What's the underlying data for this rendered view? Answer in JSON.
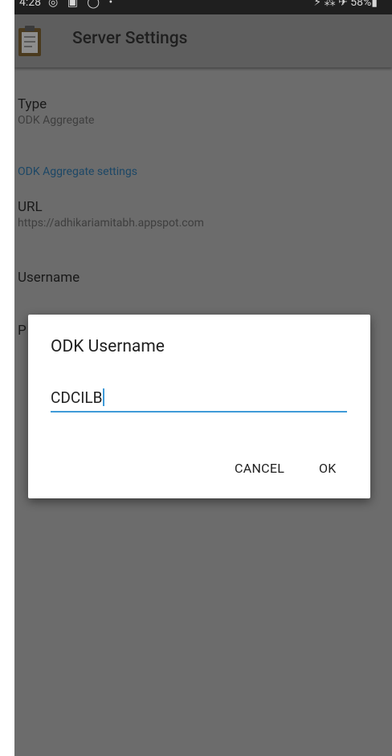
{
  "status_bar": {
    "time": "4:28",
    "left_icons": "◎ ▣ ◯ •",
    "right_text": "⚡ ⁂ ✈ 58%▮"
  },
  "toolbar": {
    "title": "Server Settings",
    "icon": "clipboard-icon"
  },
  "preferences": {
    "type": {
      "title": "Type",
      "summary": "ODK Aggregate"
    },
    "category": "ODK Aggregate settings",
    "url": {
      "title": "URL",
      "summary": "https://adhikariamitabh.appspot.com"
    },
    "username": {
      "title": "Username"
    },
    "password_initial": "P"
  },
  "dialog": {
    "title": "ODK Username",
    "input_value": "CDCILB",
    "cancel_label": "CANCEL",
    "ok_label": "OK"
  },
  "colors": {
    "dim_background": "#6c6c6c",
    "toolbar": "#5e5e5e",
    "accent": "#3f9ad8",
    "category_text": "#1c4766"
  }
}
